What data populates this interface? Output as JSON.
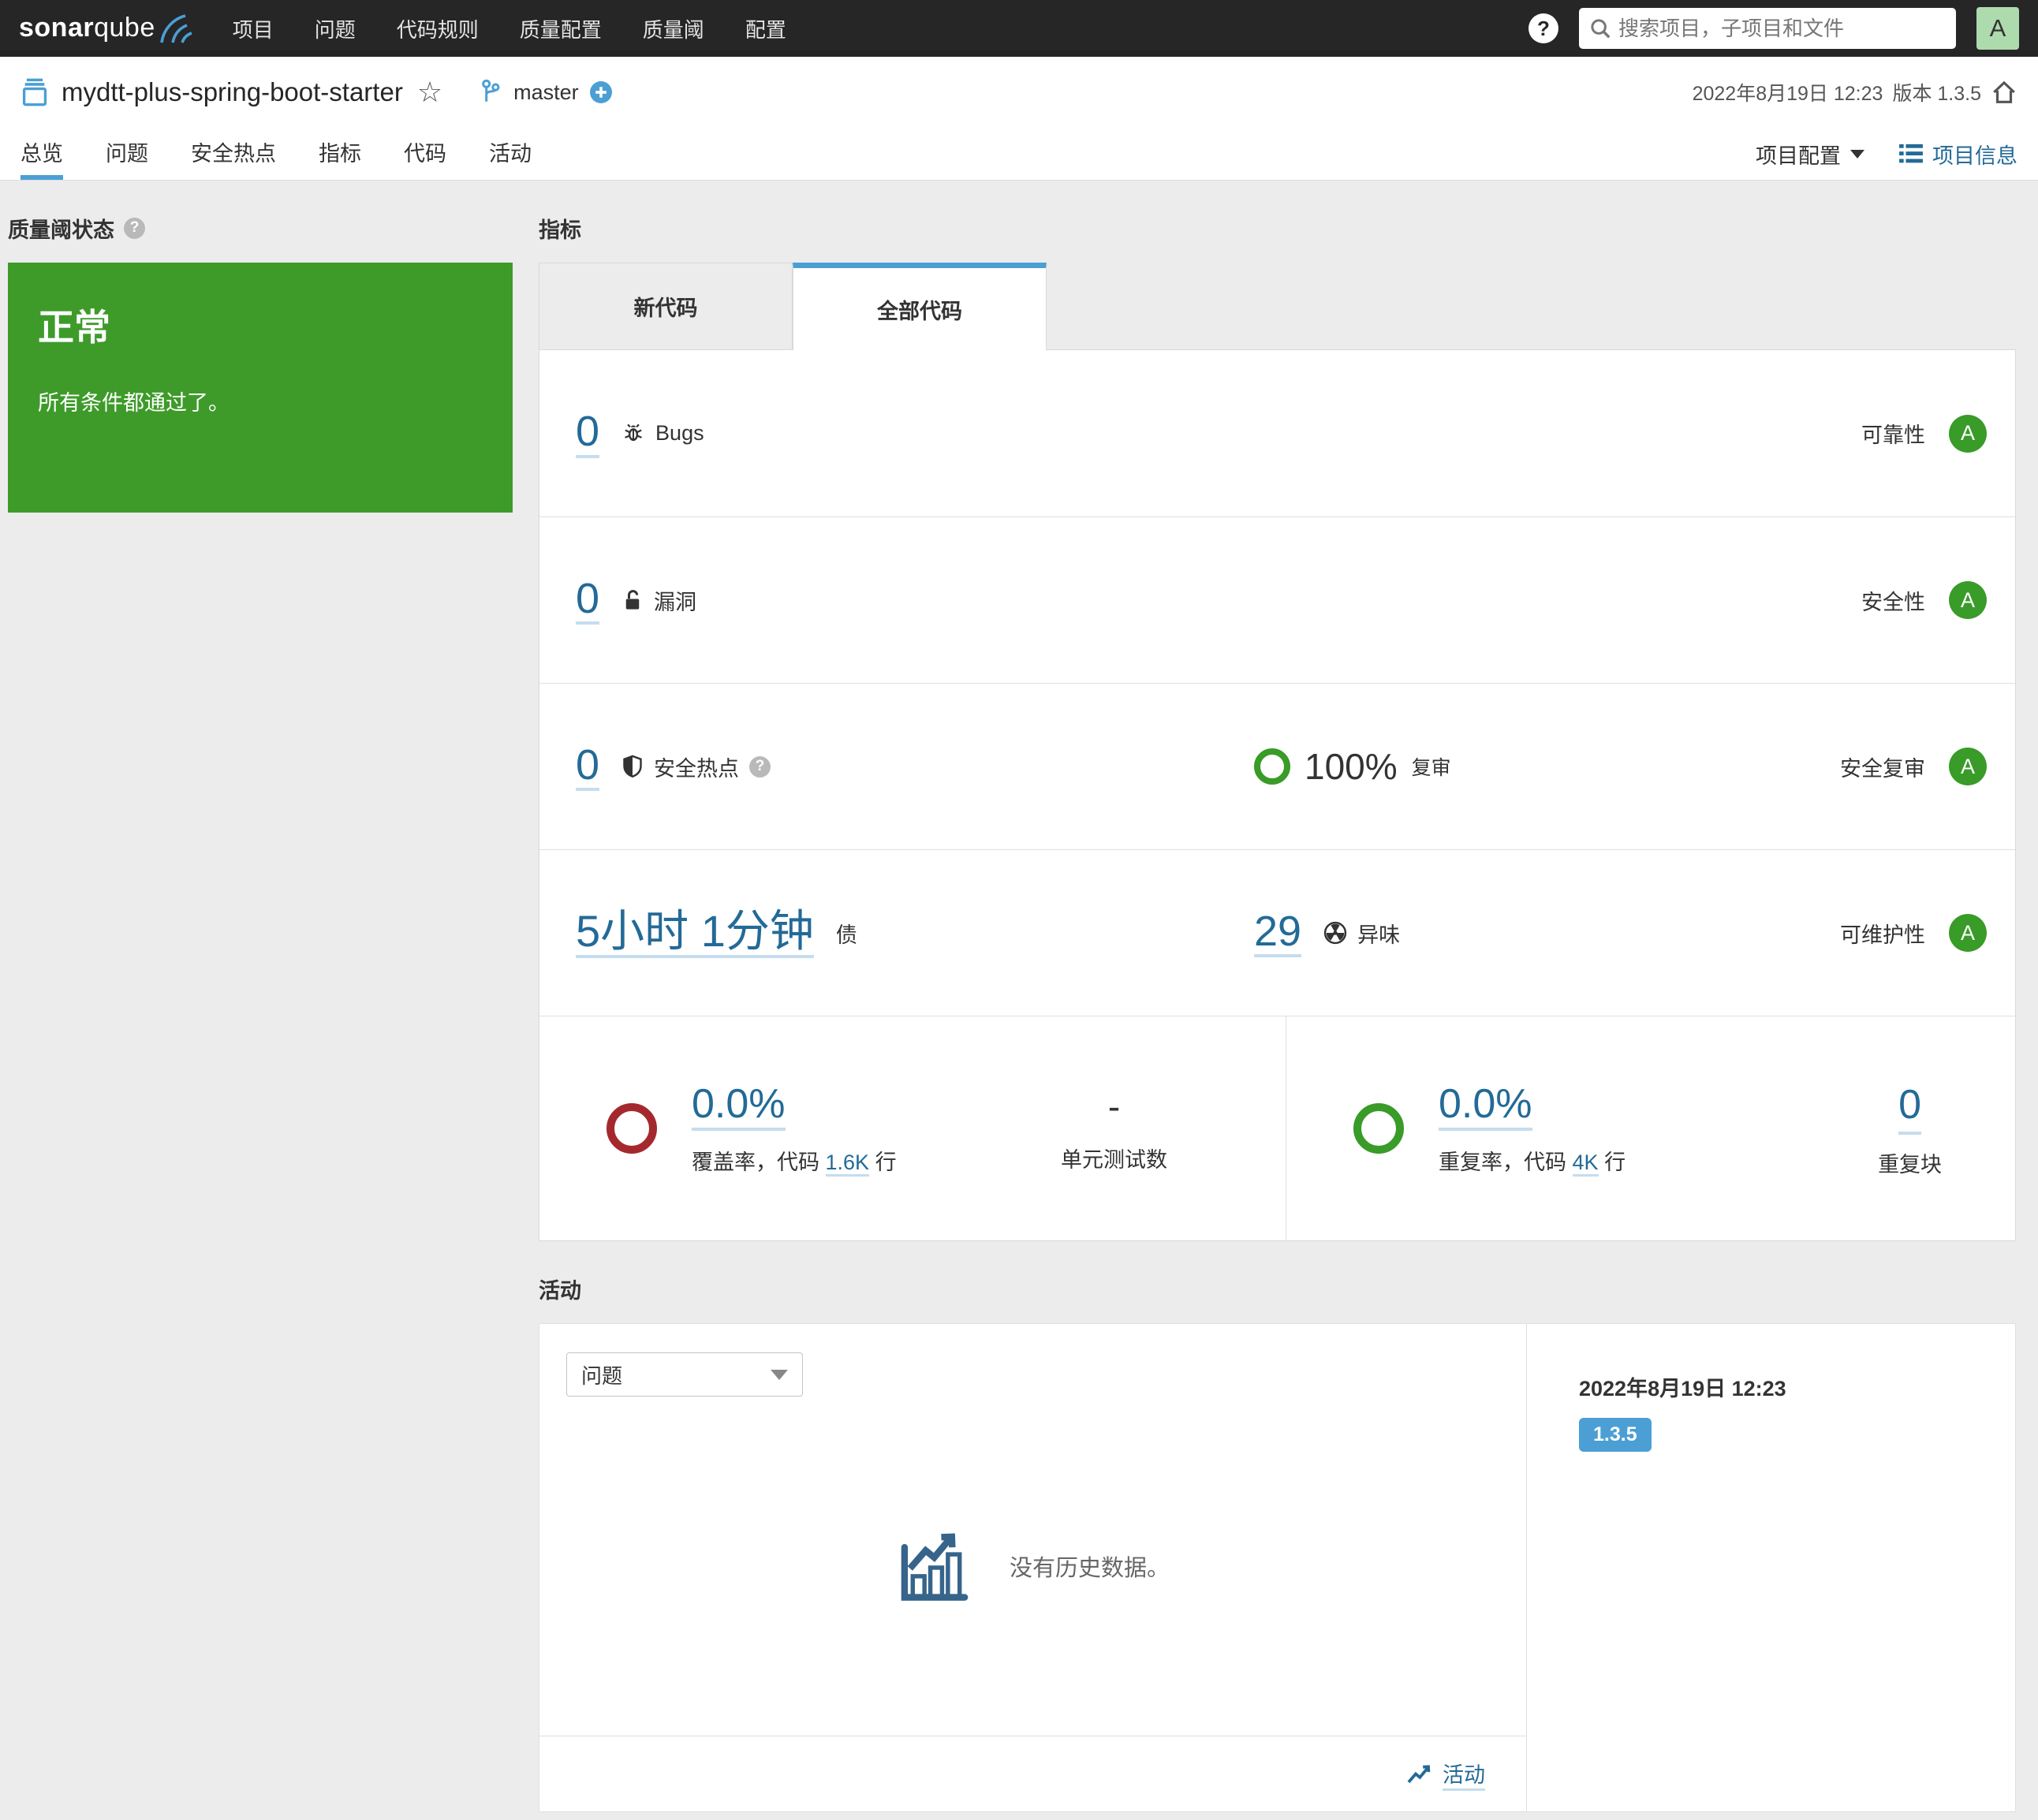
{
  "navbar": {
    "logo": "sonarqube",
    "items": [
      "项目",
      "问题",
      "代码规则",
      "质量配置",
      "质量阈",
      "配置"
    ],
    "help": "?",
    "search_placeholder": "搜索项目，子项目和文件",
    "avatar": "A"
  },
  "header": {
    "project": "mydtt-plus-spring-boot-starter",
    "branch": "master",
    "date": "2022年8月19日 12:23",
    "version": "版本 1.3.5"
  },
  "tabs": {
    "items": [
      "总览",
      "问题",
      "安全热点",
      "指标",
      "代码",
      "活动"
    ],
    "project_config": "项目配置",
    "project_info": "项目信息"
  },
  "quality_gate": {
    "title": "质量阈状态",
    "status": "正常",
    "message": "所有条件都通过了。"
  },
  "measures": {
    "title": "指标",
    "tabs": [
      "新代码",
      "全部代码"
    ],
    "rows": [
      {
        "value": "0",
        "label": "Bugs",
        "domain": "可靠性",
        "rating": "A"
      },
      {
        "value": "0",
        "label": "漏洞",
        "domain": "安全性",
        "rating": "A"
      },
      {
        "value": "0",
        "label": "安全热点",
        "review_percent": "100%",
        "review_label": "复审",
        "domain": "安全复审",
        "rating": "A"
      },
      {
        "value": "5小时 1分钟",
        "label": "债",
        "smells_value": "29",
        "smells_label": "异味",
        "domain": "可维护性",
        "rating": "A"
      }
    ],
    "coverage": {
      "percent": "0.0%",
      "label_prefix": "覆盖率，代码",
      "lines": "1.6K",
      "label_suffix": "行",
      "tests_value": "-",
      "tests_label": "单元测试数"
    },
    "duplications": {
      "percent": "0.0%",
      "label_prefix": "重复率，代码",
      "lines": "4K",
      "label_suffix": "行",
      "blocks_value": "0",
      "blocks_label": "重复块"
    }
  },
  "activity": {
    "title": "活动",
    "filter_value": "问题",
    "empty_text": "没有历史数据。",
    "sidebar_date": "2022年8月19日 12:23",
    "sidebar_version": "1.3.5",
    "footer_link": "活动"
  },
  "colors": {
    "navbar_bg": "#262626",
    "accent_blue": "#4b9fd5",
    "link_blue": "#236a97",
    "success_green": "#3e9b2a",
    "rating_a_green": "#399b28",
    "coverage_red": "#a4292e",
    "page_bg": "#ececec"
  }
}
